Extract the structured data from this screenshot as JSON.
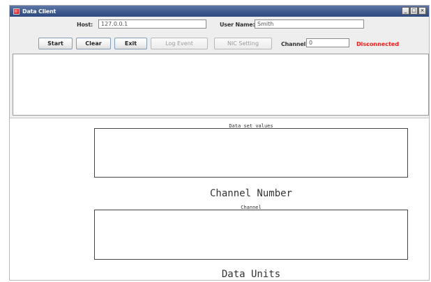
{
  "window": {
    "title": "Data Client",
    "controls": [
      "_",
      "□",
      "×"
    ]
  },
  "connection": {
    "host_label": "Host:",
    "host_value": "127.0.0.1",
    "user_label": "User Name:",
    "user_value": "Smith"
  },
  "toolbar": {
    "start_label": "Start",
    "clear_label": "Clear",
    "exit_label": "Exit",
    "log_event_label": "Log Event",
    "nic_setting_label": "NIC Setting",
    "channel_label": "Channel:",
    "channel_value": "0",
    "status_text": "Disconnected",
    "status_color": "#ff1a1a"
  },
  "plots": [
    {
      "title": "Data set values",
      "axis_label": "Channel Number"
    },
    {
      "title": "Channel",
      "axis_label": "Data Units"
    }
  ]
}
